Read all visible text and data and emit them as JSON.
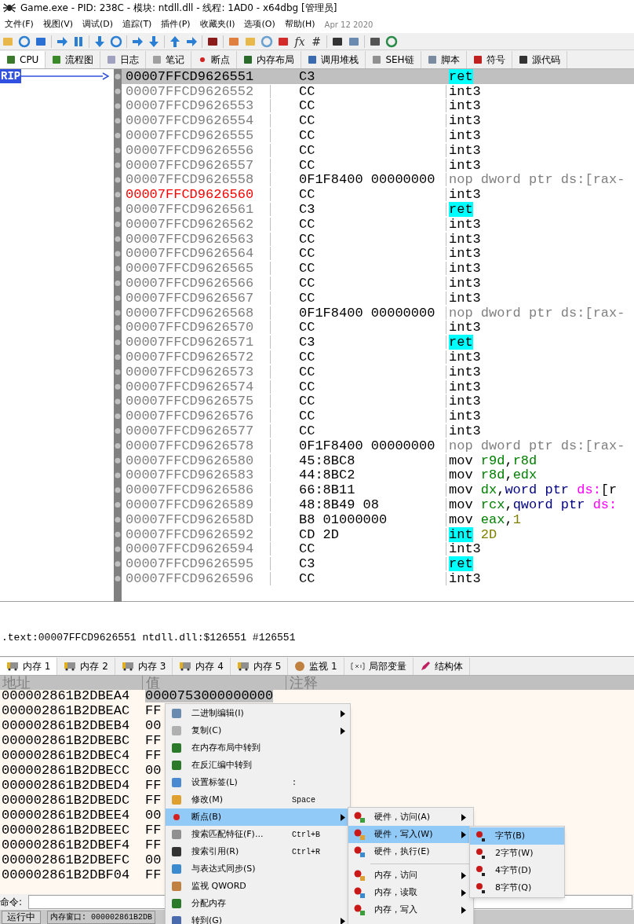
{
  "window": {
    "title": "Game.exe - PID: 238C - 模块: ntdll.dll - 线程: 1AD0 - x64dbg [管理员]"
  },
  "menu": [
    "文件(F)",
    "视图(V)",
    "调试(D)",
    "追踪(T)",
    "插件(P)",
    "收藏夹(I)",
    "选项(O)",
    "帮助(H)"
  ],
  "build_date": "Apr 12 2020",
  "toolbar_text": [
    "fx",
    "#"
  ],
  "tabs": [
    {
      "label": "CPU",
      "selected": true
    },
    {
      "label": "流程图",
      "selected": false
    },
    {
      "label": "日志",
      "selected": false
    },
    {
      "label": "笔记",
      "selected": false
    },
    {
      "label": "断点",
      "selected": false
    },
    {
      "label": "内存布局",
      "selected": false
    },
    {
      "label": "调用堆栈",
      "selected": false
    },
    {
      "label": "SEH链",
      "selected": false
    },
    {
      "label": "脚本",
      "selected": false
    },
    {
      "label": "符号",
      "selected": false
    },
    {
      "label": "源代码",
      "selected": false
    }
  ],
  "gutter": {
    "label": "RIP"
  },
  "disassembly": [
    {
      "address": "00007FFCD9626551",
      "bytes": "C3",
      "mnemonic": "ret",
      "kind": "return",
      "selected": true,
      "marked": false
    },
    {
      "address": "00007FFCD9626552",
      "bytes": "CC",
      "mnemonic": "int3",
      "kind": "plain",
      "selected": false,
      "marked": false
    },
    {
      "address": "00007FFCD9626553",
      "bytes": "CC",
      "mnemonic": "int3",
      "kind": "plain",
      "selected": false,
      "marked": false
    },
    {
      "address": "00007FFCD9626554",
      "bytes": "CC",
      "mnemonic": "int3",
      "kind": "plain",
      "selected": false,
      "marked": false
    },
    {
      "address": "00007FFCD9626555",
      "bytes": "CC",
      "mnemonic": "int3",
      "kind": "plain",
      "selected": false,
      "marked": false
    },
    {
      "address": "00007FFCD9626556",
      "bytes": "CC",
      "mnemonic": "int3",
      "kind": "plain",
      "selected": false,
      "marked": false
    },
    {
      "address": "00007FFCD9626557",
      "bytes": "CC",
      "mnemonic": "int3",
      "kind": "plain",
      "selected": false,
      "marked": false
    },
    {
      "address": "00007FFCD9626558",
      "bytes": "0F1F8400 00000000",
      "mnemonic": "nop",
      "kind": "nop",
      "operands": [
        {
          "text": "dword ptr ds:[rax-",
          "kind": "nop"
        }
      ],
      "selected": false,
      "marked": false
    },
    {
      "address": "00007FFCD9626560",
      "bytes": "CC",
      "mnemonic": "int3",
      "kind": "plain",
      "selected": false,
      "marked": true
    },
    {
      "address": "00007FFCD9626561",
      "bytes": "C3",
      "mnemonic": "ret",
      "kind": "return",
      "selected": false,
      "marked": false
    },
    {
      "address": "00007FFCD9626562",
      "bytes": "CC",
      "mnemonic": "int3",
      "kind": "plain",
      "selected": false,
      "marked": false
    },
    {
      "address": "00007FFCD9626563",
      "bytes": "CC",
      "mnemonic": "int3",
      "kind": "plain",
      "selected": false,
      "marked": false
    },
    {
      "address": "00007FFCD9626564",
      "bytes": "CC",
      "mnemonic": "int3",
      "kind": "plain",
      "selected": false,
      "marked": false
    },
    {
      "address": "00007FFCD9626565",
      "bytes": "CC",
      "mnemonic": "int3",
      "kind": "plain",
      "selected": false,
      "marked": false
    },
    {
      "address": "00007FFCD9626566",
      "bytes": "CC",
      "mnemonic": "int3",
      "kind": "plain",
      "selected": false,
      "marked": false
    },
    {
      "address": "00007FFCD9626567",
      "bytes": "CC",
      "mnemonic": "int3",
      "kind": "plain",
      "selected": false,
      "marked": false
    },
    {
      "address": "00007FFCD9626568",
      "bytes": "0F1F8400 00000000",
      "mnemonic": "nop",
      "kind": "nop",
      "operands": [
        {
          "text": "dword ptr ds:[rax-",
          "kind": "nop"
        }
      ],
      "selected": false,
      "marked": false
    },
    {
      "address": "00007FFCD9626570",
      "bytes": "CC",
      "mnemonic": "int3",
      "kind": "plain",
      "selected": false,
      "marked": false
    },
    {
      "address": "00007FFCD9626571",
      "bytes": "C3",
      "mnemonic": "ret",
      "kind": "return",
      "selected": false,
      "marked": false
    },
    {
      "address": "00007FFCD9626572",
      "bytes": "CC",
      "mnemonic": "int3",
      "kind": "plain",
      "selected": false,
      "marked": false
    },
    {
      "address": "00007FFCD9626573",
      "bytes": "CC",
      "mnemonic": "int3",
      "kind": "plain",
      "selected": false,
      "marked": false
    },
    {
      "address": "00007FFCD9626574",
      "bytes": "CC",
      "mnemonic": "int3",
      "kind": "plain",
      "selected": false,
      "marked": false
    },
    {
      "address": "00007FFCD9626575",
      "bytes": "CC",
      "mnemonic": "int3",
      "kind": "plain",
      "selected": false,
      "marked": false
    },
    {
      "address": "00007FFCD9626576",
      "bytes": "CC",
      "mnemonic": "int3",
      "kind": "plain",
      "selected": false,
      "marked": false
    },
    {
      "address": "00007FFCD9626577",
      "bytes": "CC",
      "mnemonic": "int3",
      "kind": "plain",
      "selected": false,
      "marked": false
    },
    {
      "address": "00007FFCD9626578",
      "bytes": "0F1F8400 00000000",
      "mnemonic": "nop",
      "kind": "nop",
      "operands": [
        {
          "text": "dword ptr ds:[rax-",
          "kind": "nop"
        }
      ],
      "selected": false,
      "marked": false
    },
    {
      "address": "00007FFCD9626580",
      "bytes": "45:8BC8",
      "mnemonic": "mov",
      "kind": "plain",
      "operands": [
        {
          "text": "r9d",
          "kind": "reg"
        },
        {
          "text": ",",
          "kind": "plain"
        },
        {
          "text": "r8d",
          "kind": "reg"
        }
      ],
      "selected": false,
      "marked": false
    },
    {
      "address": "00007FFCD9626583",
      "bytes": "44:8BC2",
      "mnemonic": "mov",
      "kind": "plain",
      "operands": [
        {
          "text": "r8d",
          "kind": "reg"
        },
        {
          "text": ",",
          "kind": "plain"
        },
        {
          "text": "edx",
          "kind": "reg"
        }
      ],
      "selected": false,
      "marked": false
    },
    {
      "address": "00007FFCD9626586",
      "bytes": "66:8B11",
      "mnemonic": "mov",
      "kind": "plain",
      "operands": [
        {
          "text": "dx",
          "kind": "reg"
        },
        {
          "text": ",",
          "kind": "plain"
        },
        {
          "text": "word ptr",
          "kind": "size"
        },
        {
          "text": "ds:",
          "kind": "seg",
          "spaced": true
        },
        {
          "text": "[r",
          "kind": "plain"
        }
      ],
      "selected": false,
      "marked": false
    },
    {
      "address": "00007FFCD9626589",
      "bytes": "48:8B49 08",
      "mnemonic": "mov",
      "kind": "plain",
      "operands": [
        {
          "text": "rcx",
          "kind": "reg"
        },
        {
          "text": ",",
          "kind": "plain"
        },
        {
          "text": "qword ptr",
          "kind": "size"
        },
        {
          "text": "ds:",
          "kind": "seg",
          "spaced": true
        }
      ],
      "selected": false,
      "marked": false
    },
    {
      "address": "00007FFCD962658D",
      "bytes": "B8 01000000",
      "mnemonic": "mov",
      "kind": "plain",
      "operands": [
        {
          "text": "eax",
          "kind": "reg"
        },
        {
          "text": ",",
          "kind": "plain"
        },
        {
          "text": "1",
          "kind": "num"
        }
      ],
      "selected": false,
      "marked": false
    },
    {
      "address": "00007FFCD9626592",
      "bytes": "CD 2D",
      "mnemonic": "int",
      "kind": "return",
      "operands": [
        {
          "text": "2D",
          "kind": "num"
        }
      ],
      "selected": false,
      "marked": false
    },
    {
      "address": "00007FFCD9626594",
      "bytes": "CC",
      "mnemonic": "int3",
      "kind": "plain",
      "selected": false,
      "marked": false
    },
    {
      "address": "00007FFCD9626595",
      "bytes": "C3",
      "mnemonic": "ret",
      "kind": "return",
      "selected": false,
      "marked": false
    },
    {
      "address": "00007FFCD9626596",
      "bytes": "CC",
      "mnemonic": "int3",
      "kind": "plain",
      "selected": false,
      "marked": false
    }
  ],
  "info_line": ".text:00007FFCD9626551 ntdll.dll:$126551 #126551",
  "dump_tabs": [
    {
      "label": "内存 1",
      "selected": true
    },
    {
      "label": "内存 2",
      "selected": false
    },
    {
      "label": "内存 3",
      "selected": false
    },
    {
      "label": "内存 4",
      "selected": false
    },
    {
      "label": "内存 5",
      "selected": false
    },
    {
      "label": "监视 1",
      "selected": false
    },
    {
      "label": "局部变量",
      "selected": false
    },
    {
      "label": "结构体",
      "selected": false
    }
  ],
  "dump_columns": [
    "地址",
    "值",
    "注释"
  ],
  "dump_rows": [
    {
      "address": "000002861B2DBEA4",
      "value": "0000753000000000",
      "selected": true
    },
    {
      "address": "000002861B2DBEAC",
      "value": "FF",
      "selected": false
    },
    {
      "address": "000002861B2DBEB4",
      "value": "00",
      "selected": false
    },
    {
      "address": "000002861B2DBEBC",
      "value": "FF",
      "selected": false
    },
    {
      "address": "000002861B2DBEC4",
      "value": "FF",
      "selected": false
    },
    {
      "address": "000002861B2DBECC",
      "value": "00",
      "selected": false
    },
    {
      "address": "000002861B2DBED4",
      "value": "FF",
      "selected": false
    },
    {
      "address": "000002861B2DBEDC",
      "value": "FF",
      "selected": false
    },
    {
      "address": "000002861B2DBEE4",
      "value": "00",
      "selected": false
    },
    {
      "address": "000002861B2DBEEC",
      "value": "FF",
      "selected": false
    },
    {
      "address": "000002861B2DBEF4",
      "value": "FF",
      "selected": false
    },
    {
      "address": "000002861B2DBEFC",
      "value": "00",
      "selected": false
    },
    {
      "address": "000002861B2DBF04",
      "value": "FF",
      "selected": false
    }
  ],
  "command": {
    "label": "命令:"
  },
  "status_bar": {
    "state": "运行中",
    "text": "内存窗口: 000002861B2DB"
  },
  "context_menu": [
    {
      "label": "二进制编辑(I)",
      "submenu": true,
      "selected": false
    },
    {
      "label": "复制(C)",
      "submenu": true,
      "selected": false
    },
    {
      "label": "在内存布局中转到",
      "submenu": false,
      "selected": false
    },
    {
      "label": "在反汇编中转到",
      "submenu": false,
      "selected": false
    },
    {
      "label": "设置标签(L)",
      "shortcut": ":",
      "submenu": false,
      "selected": false
    },
    {
      "label": "修改(M)",
      "shortcut": "Space",
      "submenu": false,
      "selected": false
    },
    {
      "label": "断点(B)",
      "submenu": true,
      "selected": true
    },
    {
      "label": "搜索匹配特征(F)...",
      "shortcut": "Ctrl+B",
      "submenu": false,
      "selected": false
    },
    {
      "label": "搜索引用(R)",
      "shortcut": "Ctrl+R",
      "submenu": false,
      "selected": false
    },
    {
      "label": "与表达式同步(S)",
      "submenu": false,
      "selected": false
    },
    {
      "label": "监视 QWORD",
      "submenu": false,
      "selected": false
    },
    {
      "label": "分配内存",
      "submenu": false,
      "selected": false
    },
    {
      "label": "转到(G)",
      "submenu": true,
      "selected": false
    }
  ],
  "breakpoint_menu": [
    {
      "kind": "item",
      "label": "硬件，访问(A)",
      "submenu": true,
      "selected": false
    },
    {
      "kind": "item",
      "label": "硬件，写入(W)",
      "submenu": true,
      "selected": true
    },
    {
      "kind": "item",
      "label": "硬件，执行(E)",
      "submenu": false,
      "selected": false
    },
    {
      "kind": "separator"
    },
    {
      "kind": "item",
      "label": "内存，访问",
      "submenu": true,
      "selected": false
    },
    {
      "kind": "item",
      "label": "内存，读取",
      "submenu": true,
      "selected": false
    },
    {
      "kind": "item",
      "label": "内存，写入",
      "submenu": true,
      "selected": false
    }
  ],
  "size_menu": [
    {
      "label": "字节(B)",
      "selected": true
    },
    {
      "label": "2字节(W)",
      "selected": false
    },
    {
      "label": "4字节(D)",
      "selected": false
    },
    {
      "label": "8字节(Q)",
      "selected": false
    }
  ]
}
